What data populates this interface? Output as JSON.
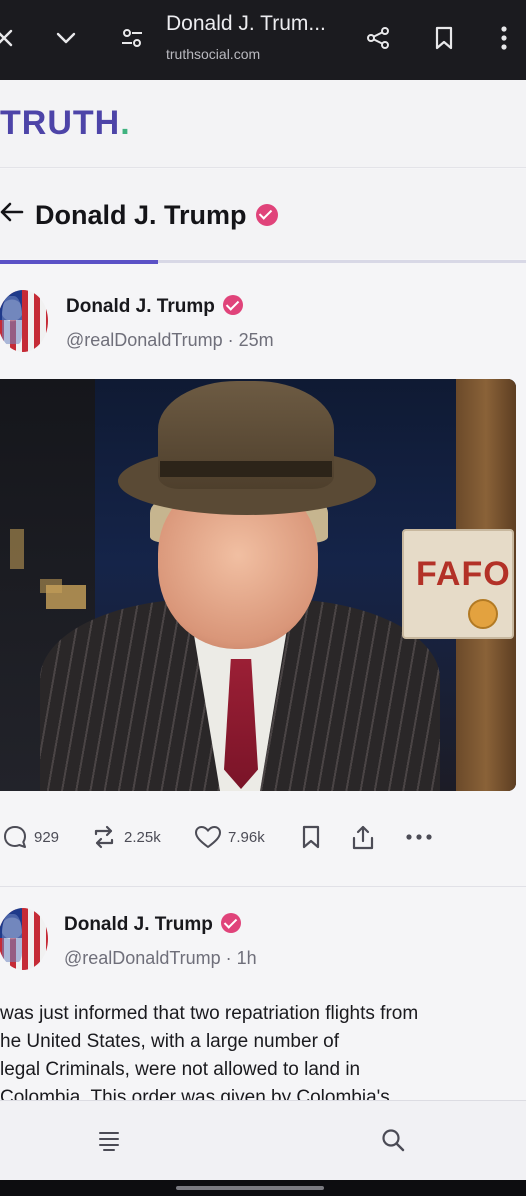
{
  "browser": {
    "title": "Donald J. Trum...",
    "url": "truthsocial.com"
  },
  "brand": {
    "logo_text": "TRUTH",
    "logo_dot": ".",
    "accent": "#4d44a8",
    "dot_color": "#3fb27f"
  },
  "profile_header": {
    "name": "Donald J. Trump",
    "verified_color": "#e0437a"
  },
  "post1": {
    "author": "Donald J. Trump",
    "handle": "@realDonaldTrump · 25m",
    "media_sign_text": "FAFO",
    "actions": {
      "replies": "929",
      "retruths": "2.25k",
      "likes": "7.96k"
    }
  },
  "post2": {
    "author": "Donald J. Trump",
    "handle": "@realDonaldTrump · 1h",
    "lines": [
      "was just informed that two repatriation flights from",
      "he United States, with a large number of",
      "legal Criminals, were not allowed to land in",
      "Colombia. This order was given by Colombia's"
    ]
  },
  "icons": {
    "close": "close-icon",
    "chevron": "chevron-down-icon",
    "tune": "tune-icon",
    "share": "share-icon",
    "bookmark": "bookmark-icon",
    "more": "more-vertical-icon",
    "back": "back-arrow-icon",
    "reply": "reply-icon",
    "retruth": "retruth-icon",
    "like": "heart-icon",
    "save": "bookmark-icon",
    "upload": "share-up-icon",
    "menu": "menu-icon",
    "search": "search-icon"
  }
}
